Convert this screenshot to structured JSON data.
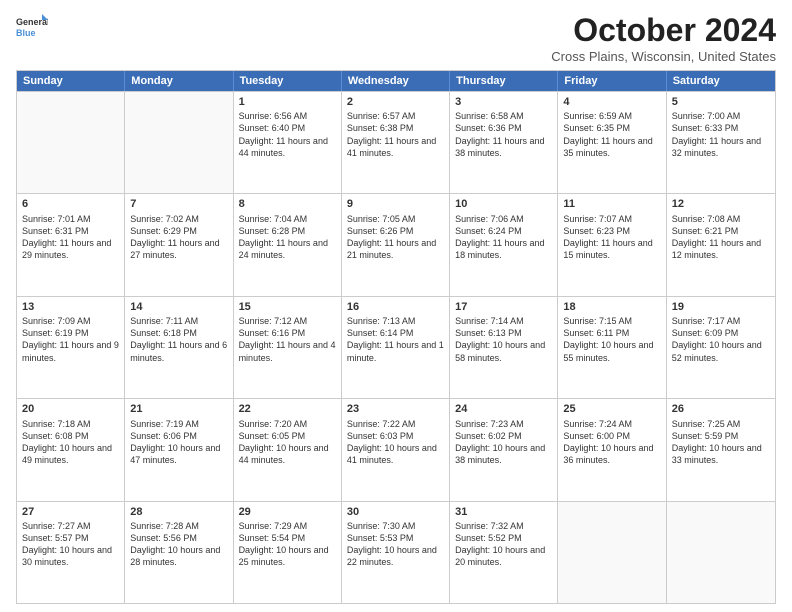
{
  "logo": {
    "line1": "General",
    "line2": "Blue"
  },
  "title": "October 2024",
  "location": "Cross Plains, Wisconsin, United States",
  "days_of_week": [
    "Sunday",
    "Monday",
    "Tuesday",
    "Wednesday",
    "Thursday",
    "Friday",
    "Saturday"
  ],
  "weeks": [
    [
      {
        "day": "",
        "empty": true
      },
      {
        "day": "",
        "empty": true
      },
      {
        "day": "1",
        "sunrise": "6:56 AM",
        "sunset": "6:40 PM",
        "daylight": "11 hours and 44 minutes."
      },
      {
        "day": "2",
        "sunrise": "6:57 AM",
        "sunset": "6:38 PM",
        "daylight": "11 hours and 41 minutes."
      },
      {
        "day": "3",
        "sunrise": "6:58 AM",
        "sunset": "6:36 PM",
        "daylight": "11 hours and 38 minutes."
      },
      {
        "day": "4",
        "sunrise": "6:59 AM",
        "sunset": "6:35 PM",
        "daylight": "11 hours and 35 minutes."
      },
      {
        "day": "5",
        "sunrise": "7:00 AM",
        "sunset": "6:33 PM",
        "daylight": "11 hours and 32 minutes."
      }
    ],
    [
      {
        "day": "6",
        "sunrise": "7:01 AM",
        "sunset": "6:31 PM",
        "daylight": "11 hours and 29 minutes."
      },
      {
        "day": "7",
        "sunrise": "7:02 AM",
        "sunset": "6:29 PM",
        "daylight": "11 hours and 27 minutes."
      },
      {
        "day": "8",
        "sunrise": "7:04 AM",
        "sunset": "6:28 PM",
        "daylight": "11 hours and 24 minutes."
      },
      {
        "day": "9",
        "sunrise": "7:05 AM",
        "sunset": "6:26 PM",
        "daylight": "11 hours and 21 minutes."
      },
      {
        "day": "10",
        "sunrise": "7:06 AM",
        "sunset": "6:24 PM",
        "daylight": "11 hours and 18 minutes."
      },
      {
        "day": "11",
        "sunrise": "7:07 AM",
        "sunset": "6:23 PM",
        "daylight": "11 hours and 15 minutes."
      },
      {
        "day": "12",
        "sunrise": "7:08 AM",
        "sunset": "6:21 PM",
        "daylight": "11 hours and 12 minutes."
      }
    ],
    [
      {
        "day": "13",
        "sunrise": "7:09 AM",
        "sunset": "6:19 PM",
        "daylight": "11 hours and 9 minutes."
      },
      {
        "day": "14",
        "sunrise": "7:11 AM",
        "sunset": "6:18 PM",
        "daylight": "11 hours and 6 minutes."
      },
      {
        "day": "15",
        "sunrise": "7:12 AM",
        "sunset": "6:16 PM",
        "daylight": "11 hours and 4 minutes."
      },
      {
        "day": "16",
        "sunrise": "7:13 AM",
        "sunset": "6:14 PM",
        "daylight": "11 hours and 1 minute."
      },
      {
        "day": "17",
        "sunrise": "7:14 AM",
        "sunset": "6:13 PM",
        "daylight": "10 hours and 58 minutes."
      },
      {
        "day": "18",
        "sunrise": "7:15 AM",
        "sunset": "6:11 PM",
        "daylight": "10 hours and 55 minutes."
      },
      {
        "day": "19",
        "sunrise": "7:17 AM",
        "sunset": "6:09 PM",
        "daylight": "10 hours and 52 minutes."
      }
    ],
    [
      {
        "day": "20",
        "sunrise": "7:18 AM",
        "sunset": "6:08 PM",
        "daylight": "10 hours and 49 minutes."
      },
      {
        "day": "21",
        "sunrise": "7:19 AM",
        "sunset": "6:06 PM",
        "daylight": "10 hours and 47 minutes."
      },
      {
        "day": "22",
        "sunrise": "7:20 AM",
        "sunset": "6:05 PM",
        "daylight": "10 hours and 44 minutes."
      },
      {
        "day": "23",
        "sunrise": "7:22 AM",
        "sunset": "6:03 PM",
        "daylight": "10 hours and 41 minutes."
      },
      {
        "day": "24",
        "sunrise": "7:23 AM",
        "sunset": "6:02 PM",
        "daylight": "10 hours and 38 minutes."
      },
      {
        "day": "25",
        "sunrise": "7:24 AM",
        "sunset": "6:00 PM",
        "daylight": "10 hours and 36 minutes."
      },
      {
        "day": "26",
        "sunrise": "7:25 AM",
        "sunset": "5:59 PM",
        "daylight": "10 hours and 33 minutes."
      }
    ],
    [
      {
        "day": "27",
        "sunrise": "7:27 AM",
        "sunset": "5:57 PM",
        "daylight": "10 hours and 30 minutes."
      },
      {
        "day": "28",
        "sunrise": "7:28 AM",
        "sunset": "5:56 PM",
        "daylight": "10 hours and 28 minutes."
      },
      {
        "day": "29",
        "sunrise": "7:29 AM",
        "sunset": "5:54 PM",
        "daylight": "10 hours and 25 minutes."
      },
      {
        "day": "30",
        "sunrise": "7:30 AM",
        "sunset": "5:53 PM",
        "daylight": "10 hours and 22 minutes."
      },
      {
        "day": "31",
        "sunrise": "7:32 AM",
        "sunset": "5:52 PM",
        "daylight": "10 hours and 20 minutes."
      },
      {
        "day": "",
        "empty": true
      },
      {
        "day": "",
        "empty": true
      }
    ]
  ]
}
